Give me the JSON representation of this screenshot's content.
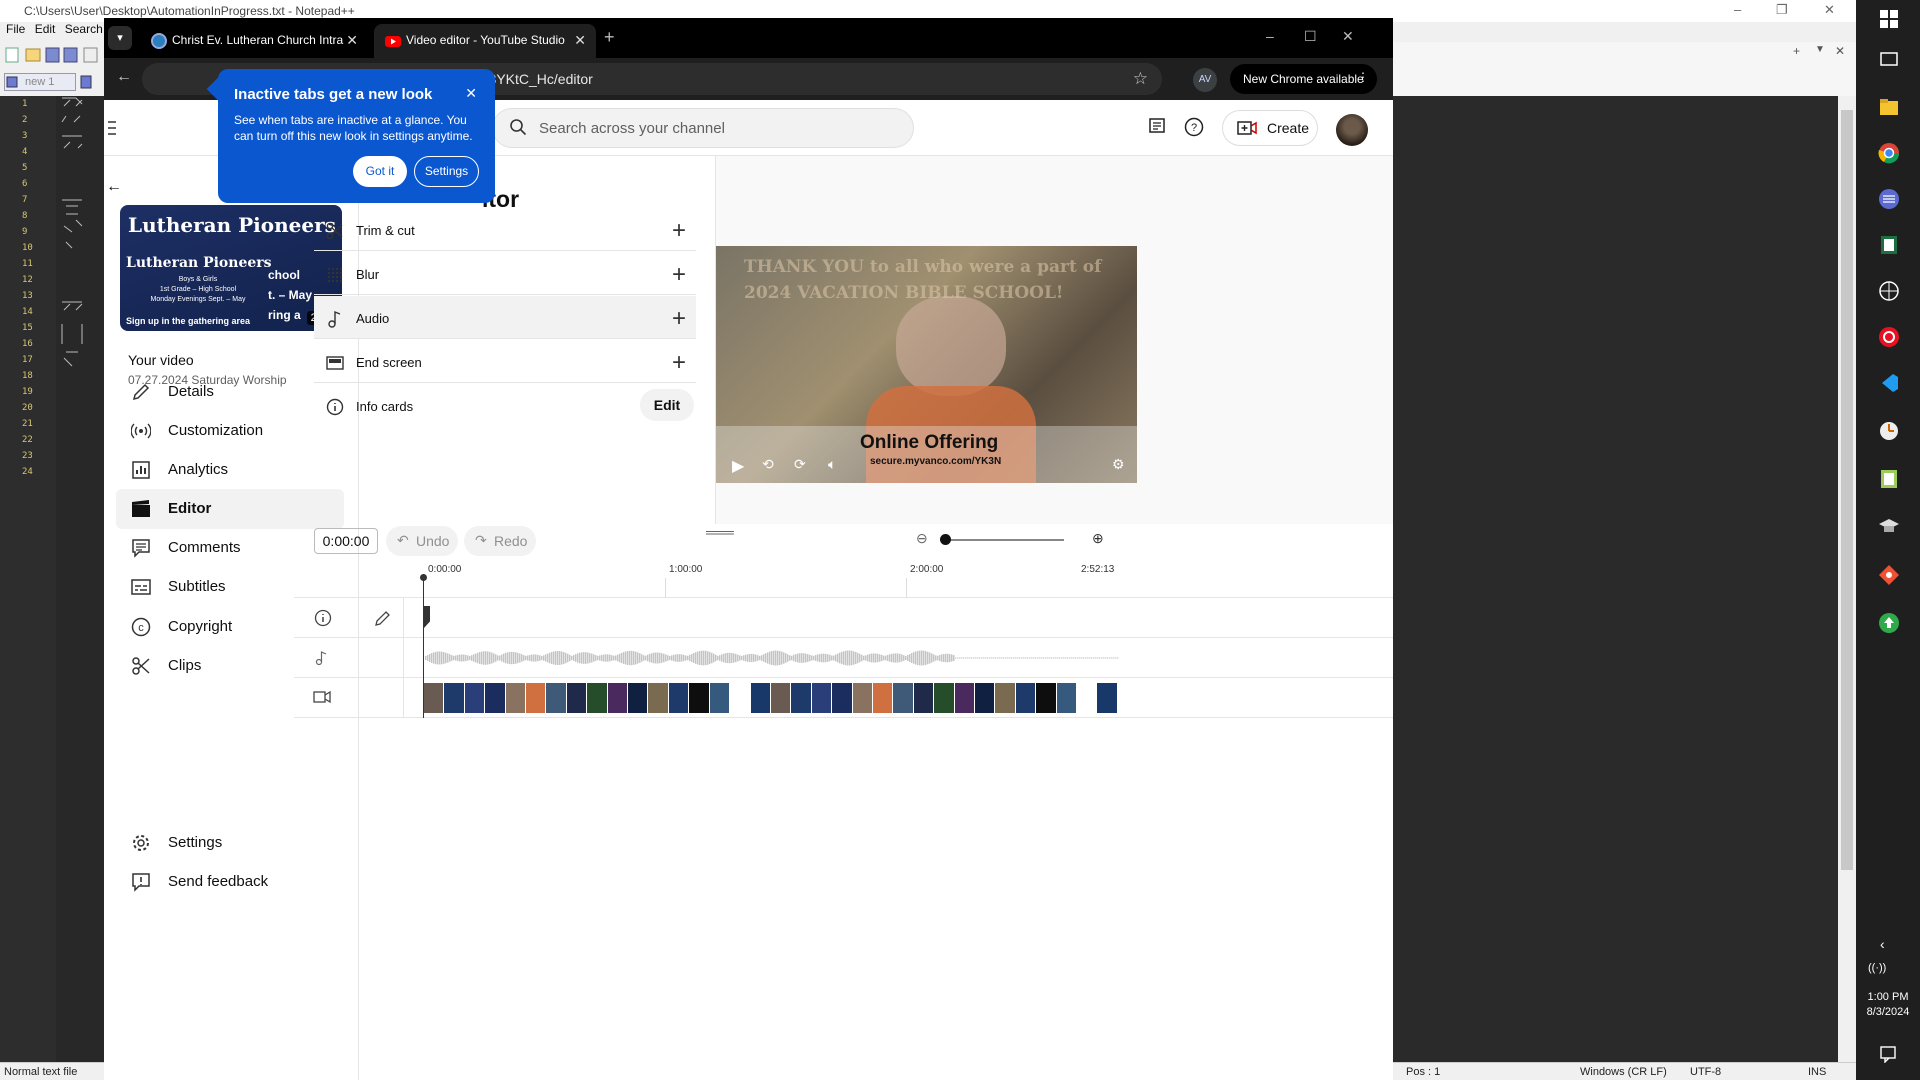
{
  "notepad": {
    "title": "C:\\Users\\User\\Desktop\\AutomationInProgress.txt - Notepad++",
    "menu": [
      "File",
      "Edit",
      "Search"
    ],
    "tab_label": "new 1",
    "line_numbers": [
      "1",
      "2",
      "3",
      "4",
      "5",
      "6",
      "7",
      "8",
      "9",
      "10",
      "11",
      "12",
      "13",
      "14",
      "15",
      "16",
      "17",
      "18",
      "19",
      "20",
      "21",
      "22",
      "23",
      "24"
    ],
    "status_left": "Normal text file",
    "status_pos": "Pos : 1",
    "status_eol": "Windows (CR LF)",
    "status_enc": "UTF-8",
    "status_ins": "INS"
  },
  "chrome": {
    "tab_list_icon": "chevron-down-icon",
    "tabs": [
      {
        "title": "Christ Ev. Lutheran Church Intra",
        "close": "✕"
      },
      {
        "title": "Video editor - YouTube Studio",
        "close": "✕"
      }
    ],
    "new_tab": "+",
    "url": "T3YKtC_Hc/editor",
    "profile_initials": "AV",
    "new_chrome": "New Chrome available",
    "window_controls": [
      "–",
      "☐",
      "✕"
    ]
  },
  "popup": {
    "title": "Inactive tabs get a new look",
    "body": "See when tabs are inactive at a glance. You can turn off this new look in settings anytime.",
    "got_it": "Got it",
    "settings": "Settings",
    "close": "✕"
  },
  "studio": {
    "search_placeholder": "Search across your channel",
    "create_label": "Create",
    "page_title": "Video editor",
    "page_title_visible": "itor",
    "your_video": "Your video",
    "video_name": "07.27.2024 Saturday Worship",
    "thumbnail": {
      "title": "Lutheran Pioneers",
      "subtitle": "Lutheran Pioneers",
      "lines": [
        "Boys & Girls",
        "1st Grade – High School",
        "Monday Evenings Sept. – May"
      ],
      "bottom": "Sign up in the gathering area",
      "right_lines": [
        "chool",
        "t. – May",
        "ring a"
      ],
      "duration": "2:53"
    },
    "nav": [
      {
        "label": "Details",
        "icon": "pencil-icon"
      },
      {
        "label": "Customization",
        "icon": "broadcast-icon"
      },
      {
        "label": "Analytics",
        "icon": "bar-chart-icon"
      },
      {
        "label": "Editor",
        "icon": "clapperboard-icon"
      },
      {
        "label": "Comments",
        "icon": "comment-icon"
      },
      {
        "label": "Subtitles",
        "icon": "subtitles-icon"
      },
      {
        "label": "Copyright",
        "icon": "copyright-icon"
      },
      {
        "label": "Clips",
        "icon": "scissors-icon"
      }
    ],
    "nav_bottom": [
      {
        "label": "Settings",
        "icon": "gear-icon"
      },
      {
        "label": "Send feedback",
        "icon": "feedback-icon"
      }
    ],
    "tools": [
      {
        "label": "Trim & cut",
        "icon": "scissors-icon",
        "action": "+"
      },
      {
        "label": "Blur",
        "icon": "blur-grid-icon",
        "action": "+"
      },
      {
        "label": "Audio",
        "icon": "music-note-icon",
        "action": "+"
      },
      {
        "label": "End screen",
        "icon": "end-screen-icon",
        "action": "+"
      },
      {
        "label": "Info cards",
        "icon": "info-icon",
        "action": "Edit"
      }
    ],
    "preview": {
      "overlay_lines": [
        "THANK YOU to all who were a part of",
        "2024 VACATION BIBLE SCHOOL!"
      ],
      "offering": "Online Offering",
      "offering_url": "secure.myvanco.com/YK3N"
    },
    "timeline": {
      "timecode": "0:00:00",
      "undo": "Undo",
      "redo": "Redo",
      "ticks": [
        "0:00:00",
        "1:00:00",
        "2:00:00",
        "2:52:13"
      ],
      "zoom_level": 0
    }
  },
  "taskbar": {
    "time": "1:00 PM",
    "date": "8/3/2024"
  },
  "colors": {
    "popup_blue": "#0b57d0",
    "notepad_dark": "#2d2d2d",
    "taskbar": "#1f1f1f"
  }
}
